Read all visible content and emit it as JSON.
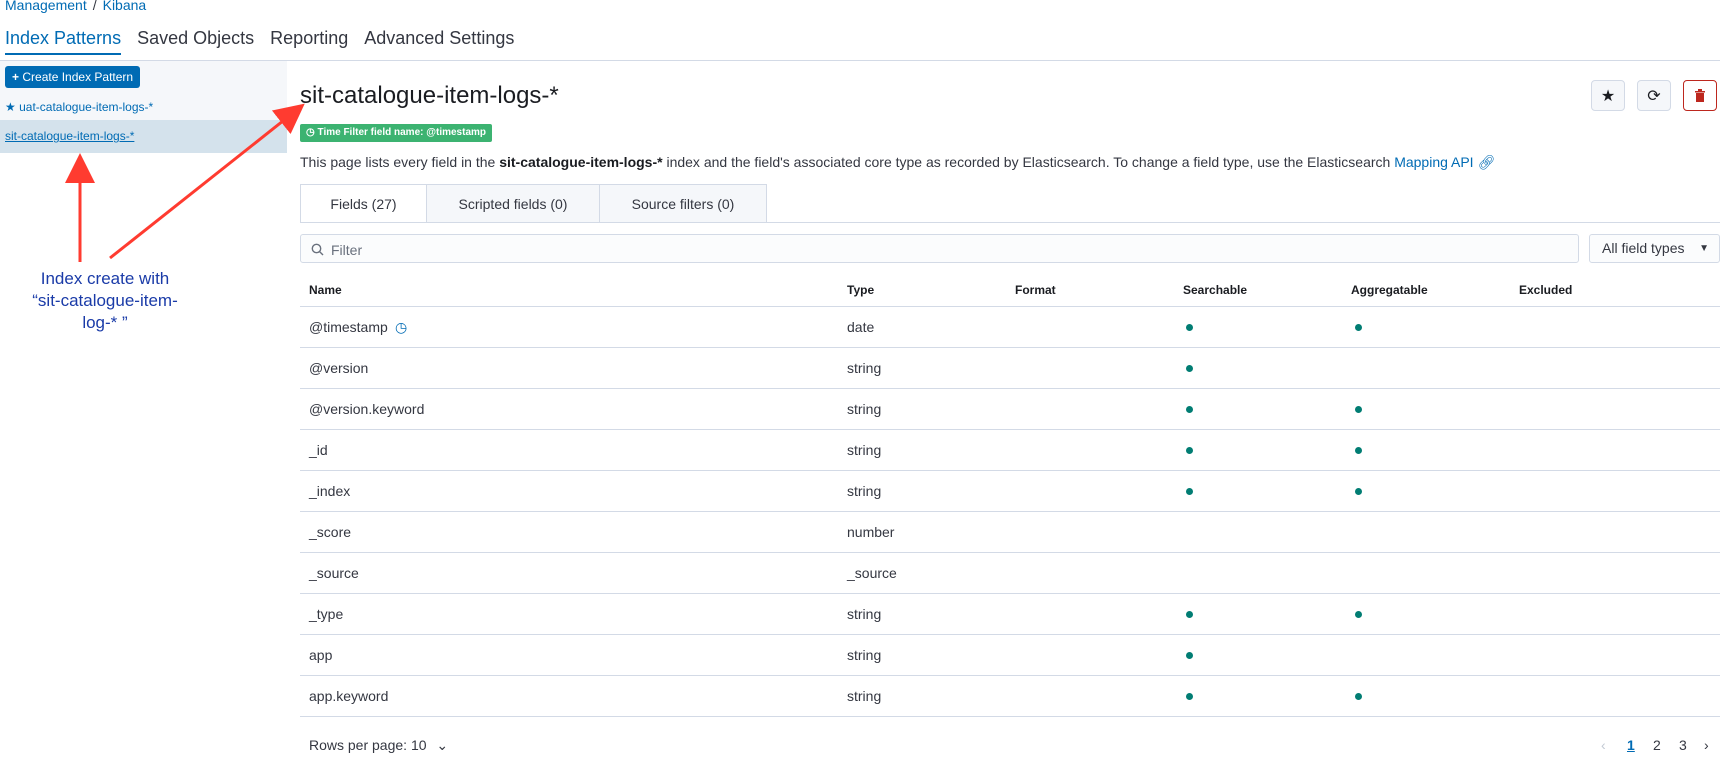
{
  "breadcrumb": {
    "items": [
      "Management",
      "Kibana"
    ],
    "separator": "/"
  },
  "nav_tabs": [
    "Index Patterns",
    "Saved Objects",
    "Reporting",
    "Advanced Settings"
  ],
  "sidebar": {
    "create_button": "Create Index Pattern",
    "items": [
      {
        "label": "uat-catalogue-item-logs-*",
        "default": true
      },
      {
        "label": "sit-catalogue-item-logs-*",
        "selected": true
      }
    ]
  },
  "annotation": {
    "text_1": "Index create with",
    "text_2": "“sit-catalogue-item-",
    "text_3": "log-* ”",
    "color": "#ff3b30"
  },
  "page": {
    "title": "sit-catalogue-item-logs-*",
    "time_filter_badge": "Time Filter field name: @timestamp",
    "description_prefix": "This page lists every field in the ",
    "description_index": "sit-catalogue-item-logs-*",
    "description_suffix": " index and the field's associated core type as recorded by Elasticsearch. To change a field type, use the Elasticsearch ",
    "mapping_link": "Mapping API"
  },
  "field_tabs": [
    "Fields (27)",
    "Scripted fields (0)",
    "Source filters (0)"
  ],
  "filter": {
    "placeholder": "Filter",
    "type_select": "All field types"
  },
  "table": {
    "headers": [
      "Name",
      "Type",
      "Format",
      "Searchable",
      "Aggregatable",
      "Excluded"
    ],
    "rows": [
      {
        "name": "@timestamp",
        "type": "date",
        "searchable": true,
        "aggregatable": true,
        "time": true
      },
      {
        "name": "@version",
        "type": "string",
        "searchable": true,
        "aggregatable": false
      },
      {
        "name": "@version.keyword",
        "type": "string",
        "searchable": true,
        "aggregatable": true
      },
      {
        "name": "_id",
        "type": "string",
        "searchable": true,
        "aggregatable": true
      },
      {
        "name": "_index",
        "type": "string",
        "searchable": true,
        "aggregatable": true
      },
      {
        "name": "_score",
        "type": "number",
        "searchable": false,
        "aggregatable": false
      },
      {
        "name": "_source",
        "type": "_source",
        "searchable": false,
        "aggregatable": false
      },
      {
        "name": "_type",
        "type": "string",
        "searchable": true,
        "aggregatable": true
      },
      {
        "name": "app",
        "type": "string",
        "searchable": true,
        "aggregatable": false
      },
      {
        "name": "app.keyword",
        "type": "string",
        "searchable": true,
        "aggregatable": true
      }
    ]
  },
  "pagination": {
    "rows_per_page": "Rows per page: 10",
    "pages": [
      "1",
      "2",
      "3"
    ],
    "current": "1"
  },
  "colors": {
    "accent": "#006bb4",
    "badge": "#3cb371",
    "dot": "#017d73",
    "danger": "#bd271e"
  }
}
